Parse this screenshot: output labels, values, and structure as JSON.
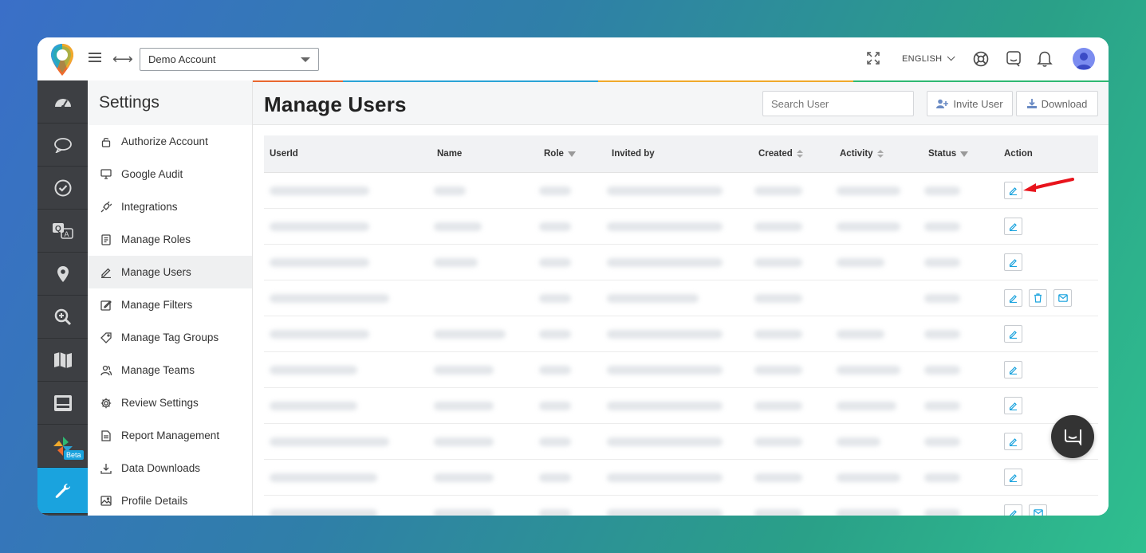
{
  "header": {
    "account_selected": "Demo Account",
    "language": "ENGLISH"
  },
  "rail": {
    "items": [
      {
        "icon": "dashboard-gauge-icon"
      },
      {
        "icon": "chat-bubble-icon"
      },
      {
        "icon": "check-circle-icon"
      },
      {
        "icon": "translate-qa-icon"
      },
      {
        "icon": "map-pin-icon"
      },
      {
        "icon": "zoom-search-icon"
      },
      {
        "icon": "map-icon"
      },
      {
        "icon": "monitor-icon"
      },
      {
        "icon": "pinwheel-icon",
        "badge": "Beta"
      },
      {
        "icon": "wrench-icon",
        "active": true
      }
    ]
  },
  "settings": {
    "title": "Settings",
    "items": [
      {
        "label": "Authorize Account",
        "icon": "lock-icon"
      },
      {
        "label": "Google Audit",
        "icon": "monitor-icon"
      },
      {
        "label": "Integrations",
        "icon": "plug-icon"
      },
      {
        "label": "Manage Roles",
        "icon": "clipboard-icon"
      },
      {
        "label": "Manage Users",
        "icon": "pencil-icon",
        "active": true
      },
      {
        "label": "Manage Filters",
        "icon": "edit-square-icon"
      },
      {
        "label": "Manage Tag Groups",
        "icon": "tag-icon"
      },
      {
        "label": "Manage Teams",
        "icon": "team-icon"
      },
      {
        "label": "Review Settings",
        "icon": "gear-icon"
      },
      {
        "label": "Report Management",
        "icon": "document-icon"
      },
      {
        "label": "Data Downloads",
        "icon": "download-icon"
      },
      {
        "label": "Profile Details",
        "icon": "image-icon"
      }
    ]
  },
  "main": {
    "title": "Manage Users",
    "search_placeholder": "Search User",
    "invite_label": "Invite User",
    "download_label": "Download",
    "columns": {
      "userid": "UserId",
      "name": "Name",
      "role": "Role",
      "invited_by": "Invited by",
      "created": "Created",
      "activity": "Activity",
      "status": "Status",
      "action": "Action"
    }
  },
  "colors": {
    "accent": "#1aa3de",
    "rail": "#3d3f43",
    "arrow": "#e8141c"
  }
}
